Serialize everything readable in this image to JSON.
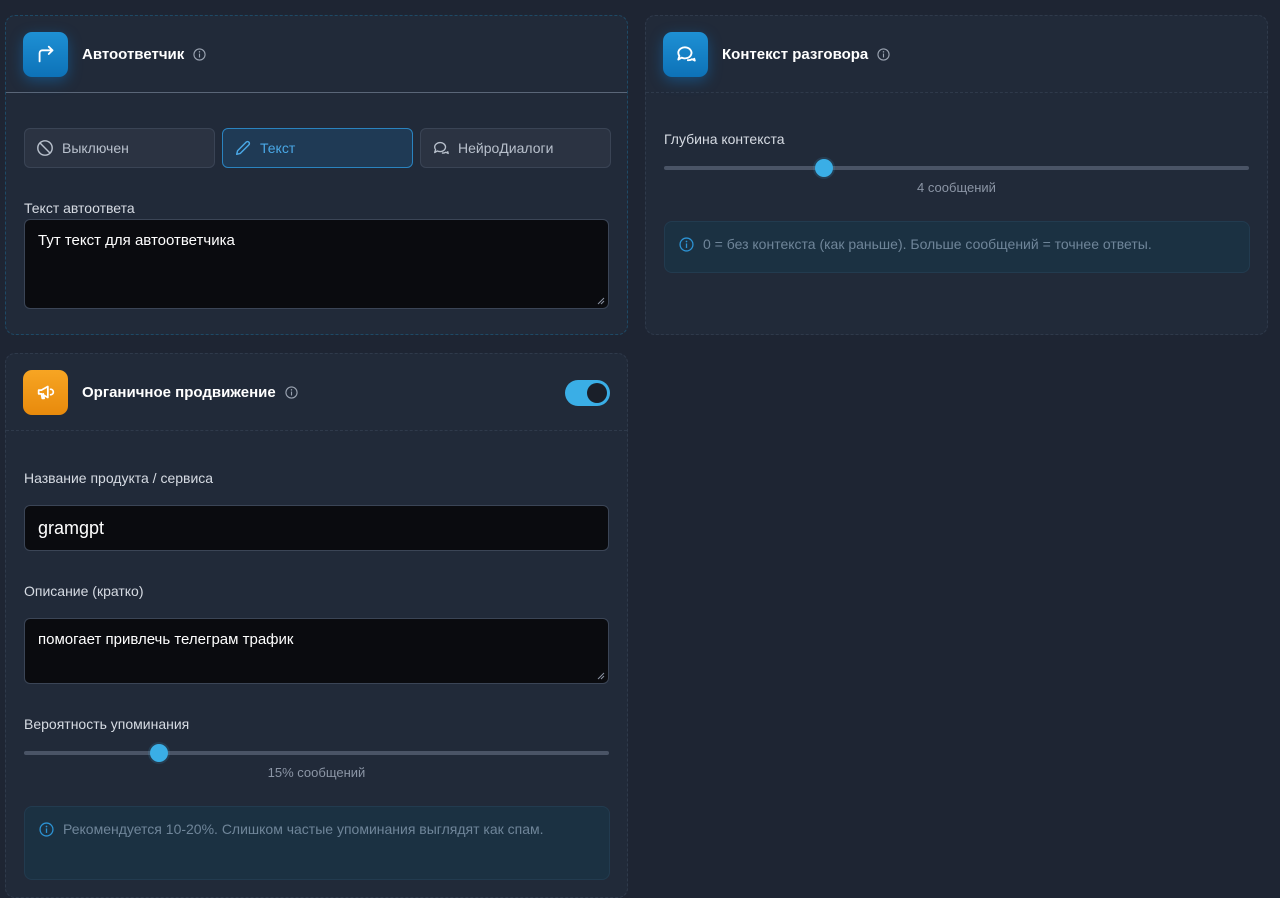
{
  "autoresponder": {
    "title": "Автоответчик",
    "modes": [
      {
        "label": "Выключен",
        "icon": "ban-icon"
      },
      {
        "label": "Текст",
        "icon": "pencil-icon"
      },
      {
        "label": "НейроДиалоги",
        "icon": "chat-bubbles-icon"
      }
    ],
    "selected_mode": "Текст",
    "text_label": "Текст автоответа",
    "text_value": "Тут текст для автоответчика"
  },
  "context": {
    "title": "Контекст разговора",
    "depth_label": "Глубина контекста",
    "depth_value": 4,
    "depth_caption": "4 сообщений",
    "note": "0 = без контекста (как раньше). Больше сообщений = точнее ответы."
  },
  "organic": {
    "title": "Органичное продвижение",
    "enabled": true,
    "product_label": "Название продукта / сервиса",
    "product_value": "gramgpt",
    "description_label": "Описание (кратко)",
    "description_value": "помогает привлечь телеграм трафик",
    "probability_label": "Вероятность упоминания",
    "probability_value_percent": 15,
    "probability_caption": "15% сообщений",
    "note": "Рекомендуется 10-20%. Слишком частые упоминания выглядят как спам."
  },
  "colors": {
    "accent": "#3aaee6",
    "blue_icon": "#1483c9",
    "orange_icon": "#f29a17",
    "background": "#1e2533"
  }
}
